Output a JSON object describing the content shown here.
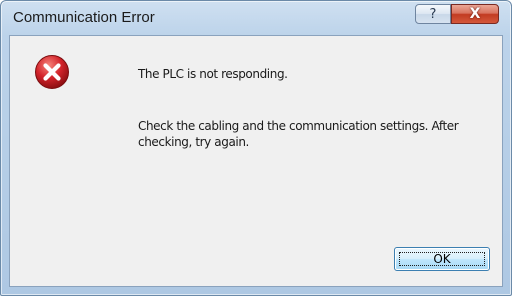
{
  "window": {
    "title": "Communication Error"
  },
  "titlebar": {
    "help_glyph": "?",
    "close_glyph": "X"
  },
  "dialog": {
    "icon": "error-icon",
    "message_primary": "The PLC is not responding.",
    "message_secondary": "Check the cabling and the communication settings. After checking, try again.",
    "ok_label": "OK"
  },
  "colors": {
    "error_icon": "#d2232a",
    "close_button": "#c23b22",
    "dialog_background": "#f0f0f0"
  }
}
